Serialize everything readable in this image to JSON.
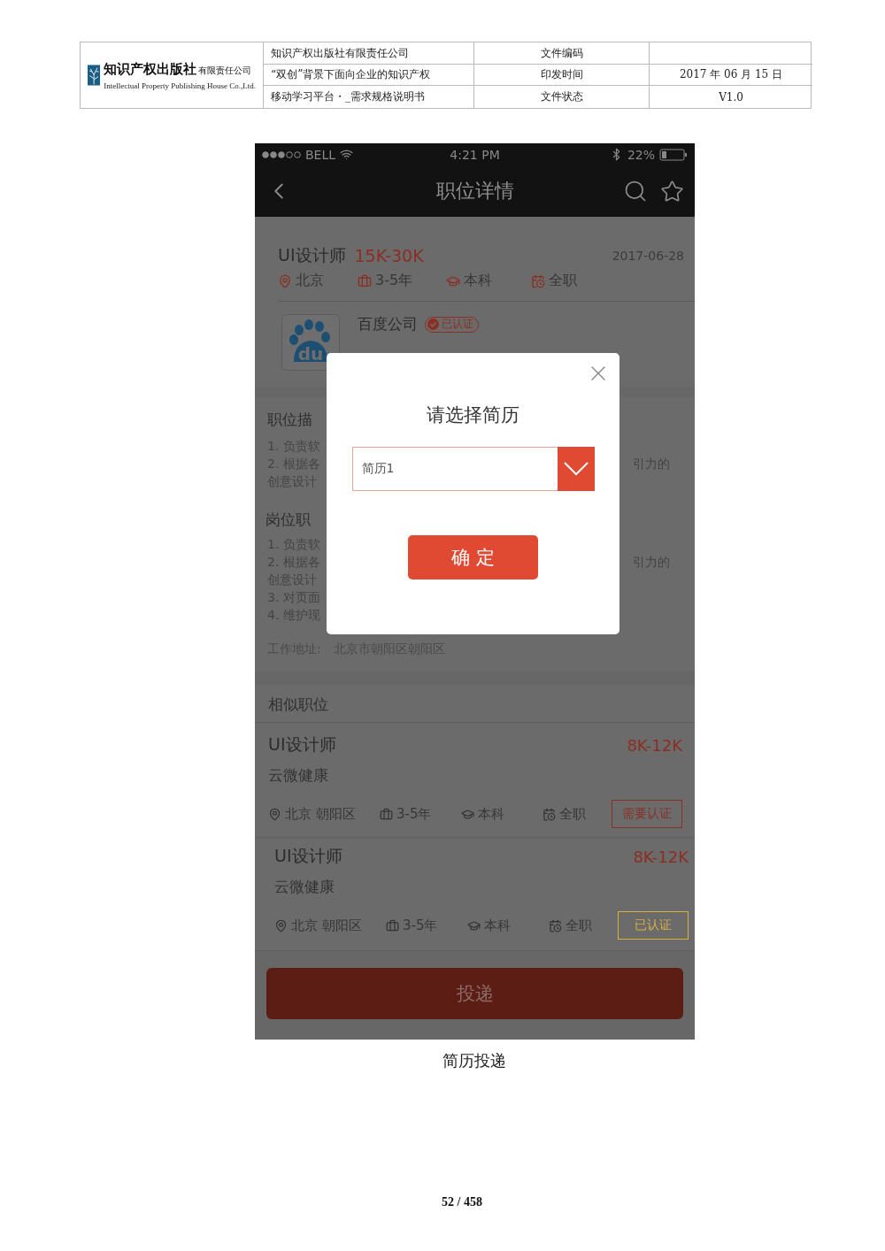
{
  "doc_header": {
    "logo": {
      "name": "知识产权出版社",
      "suffix": "有限责任公司",
      "english": "Intellectual Property Publishing House Co.,Ltd."
    },
    "rows": [
      {
        "text": "知识产权出版社有限责任公司",
        "label": "文件编码"
      },
      {
        "text": "“双创”背景下面向企业的知识产权",
        "label": "印发时间",
        "value": "2017 年 06 月 15 日"
      },
      {
        "text": "移动学习平台・_需求规格说明书",
        "label": "文件状态",
        "value": "V1.0"
      }
    ]
  },
  "phone": {
    "status_bar": {
      "carrier": "BELL",
      "time": "4:21 PM",
      "battery": "22%"
    },
    "nav": {
      "title": "职位详情"
    },
    "job": {
      "title": "UI设计师",
      "salary": "15K-30K",
      "date": "2017-06-28",
      "tags": [
        {
          "kind": "location",
          "text": "北京"
        },
        {
          "kind": "experience",
          "text": "3-5年"
        },
        {
          "kind": "education",
          "text": "本科"
        },
        {
          "kind": "type",
          "text": "全职"
        }
      ]
    },
    "company": {
      "logo_text": "du",
      "name": "百度公司",
      "badge": "已认证"
    },
    "sections": [
      {
        "heading": "职位描",
        "lines": [
          {
            "left": "1. 负责软"
          },
          {
            "left": "2. 根据各",
            "right": "引力的"
          },
          {
            "left": "创意设计"
          }
        ]
      },
      {
        "heading": "岗位职",
        "lines": [
          {
            "left": "1. 负责软"
          },
          {
            "left": "2. 根据各",
            "right": "引力的"
          },
          {
            "left": "创意设计"
          },
          {
            "left": "3. 对页面"
          },
          {
            "left": "4. 维护现"
          }
        ]
      }
    ],
    "address": {
      "label": "工作地址:",
      "value": "北京市朝阳区朝阳区"
    },
    "similar": {
      "heading": "相似职位",
      "items": [
        {
          "title": "UI设计师",
          "salary": "8K-12K",
          "company": "云微健康",
          "badge": {
            "kind": "required",
            "text": "需要认证"
          },
          "tags": [
            {
              "kind": "location",
              "text": "北京 朝阳区"
            },
            {
              "kind": "experience",
              "text": "3-5年"
            },
            {
              "kind": "education",
              "text": "本科"
            },
            {
              "kind": "type",
              "text": "全职"
            }
          ]
        },
        {
          "title": "UI设计师",
          "salary": "8K-12K",
          "company": "云微健康",
          "badge": {
            "kind": "verified",
            "text": "已认证"
          },
          "tags": [
            {
              "kind": "location",
              "text": "北京 朝阳区"
            },
            {
              "kind": "experience",
              "text": "3-5年"
            },
            {
              "kind": "education",
              "text": "本科"
            },
            {
              "kind": "type",
              "text": "全职"
            }
          ]
        }
      ]
    },
    "apply_button": "投递",
    "modal": {
      "title": "请选择简历",
      "select": {
        "value": "简历1"
      },
      "confirm": "确 定"
    }
  },
  "caption": "简历投递",
  "page_number": "52 / 458"
}
